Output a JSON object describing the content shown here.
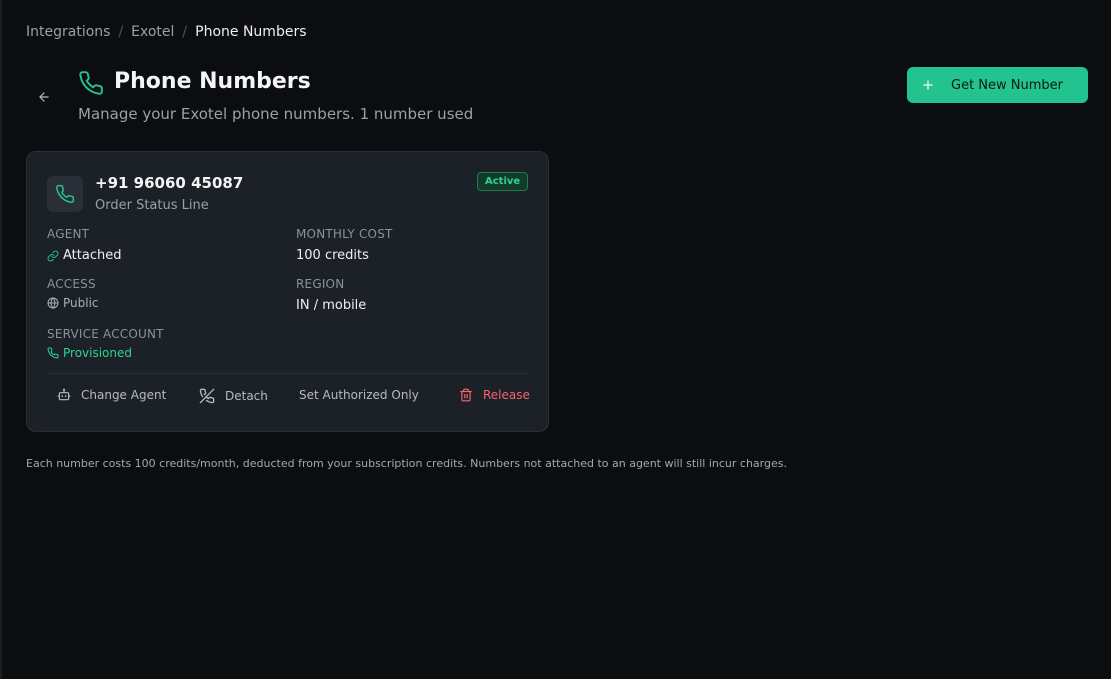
{
  "breadcrumb": {
    "items": [
      "Integrations",
      "Exotel",
      "Phone Numbers"
    ],
    "separator": "/"
  },
  "header": {
    "title": "Phone Numbers",
    "subtitle": "Manage your Exotel phone numbers.  1 number used",
    "title_icon": "phone-icon",
    "back_icon": "arrow-left-icon"
  },
  "actions": {
    "get_new_number_label": "Get New Number",
    "get_new_number_icon": "plus-icon"
  },
  "number_card": {
    "number": "+91 96060 45087",
    "label": "Order Status Line",
    "status": "Active",
    "fields": {
      "agent": {
        "label": "AGENT",
        "value": "Attached",
        "icon": "link-icon"
      },
      "monthly_cost": {
        "label": "MONTHLY COST",
        "value": "100 credits"
      },
      "access": {
        "label": "ACCESS",
        "value": "Public",
        "icon": "globe-icon"
      },
      "region": {
        "label": "REGION",
        "value": "IN / mobile"
      },
      "service_account": {
        "label": "SERVICE ACCOUNT",
        "value": "Provisioned",
        "icon": "phone-icon"
      }
    },
    "buttons": {
      "change_agent": "Change Agent",
      "detach": "Detach",
      "set_authorized_only": "Set Authorized Only",
      "release": "Release"
    }
  },
  "footnote": "Each number costs 100 credits/month, deducted from your subscription credits. Numbers not attached to an agent will still incur charges.",
  "colors": {
    "background": "#0c0d11",
    "card": "#1c2027",
    "accent": "#22c38e",
    "status_green": "#2fd391",
    "danger": "#f2666e"
  }
}
